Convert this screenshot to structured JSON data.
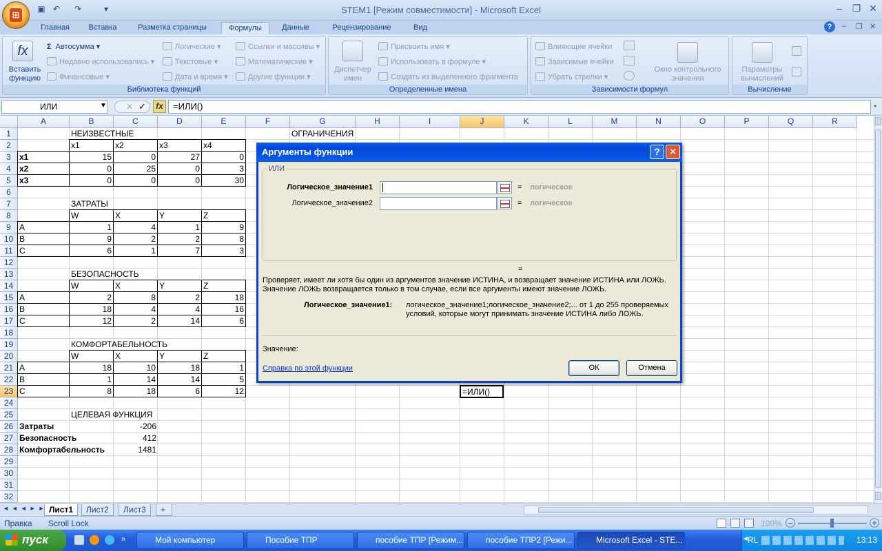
{
  "window": {
    "title": "STEM1  [Режим совместимости] - Microsoft Excel"
  },
  "tabs": [
    {
      "label": "Главная"
    },
    {
      "label": "Вставка"
    },
    {
      "label": "Разметка страницы"
    },
    {
      "label": "Формулы",
      "active": true
    },
    {
      "label": "Данные"
    },
    {
      "label": "Рецензирование"
    },
    {
      "label": "Вид"
    }
  ],
  "ribbon": {
    "g1": {
      "label": "Библиотека функций",
      "insert": "Вставить функцию",
      "autosum": "Автосумма",
      "recent": "Недавно использовались",
      "financial": "Финансовые",
      "logical": "Логические",
      "text": "Текстовые",
      "datetime": "Дата и время",
      "lookup": "Ссылки и массивы",
      "math": "Математические",
      "more": "Другие функции"
    },
    "g2": {
      "label": "Определенные имена",
      "manager": "Диспетчер имен",
      "define": "Присвоить имя",
      "use": "Использовать в формуле",
      "create": "Создать из выделенного фрагмента"
    },
    "g3": {
      "label": "Зависимости формул",
      "precedents": "Влияющие ячейки",
      "dependents": "Зависимые ячейки",
      "remove": "Убрать стрелки",
      "watch": "Окно контрольного значения"
    },
    "g4": {
      "label": "Вычисление",
      "options": "Параметры вычислений"
    }
  },
  "formula_bar": {
    "name_box": "ИЛИ",
    "formula": "=ИЛИ()"
  },
  "columns": [
    "A",
    "B",
    "C",
    "D",
    "E",
    "F",
    "G",
    "H",
    "I",
    "J",
    "K",
    "L",
    "M",
    "N",
    "O",
    "P",
    "Q",
    "R"
  ],
  "rows": [
    "1",
    "2",
    "3",
    "4",
    "5",
    "6",
    "7",
    "8",
    "9",
    "10",
    "11",
    "12",
    "13",
    "14",
    "15",
    "16",
    "17",
    "18",
    "19",
    "20",
    "21",
    "22",
    "23",
    "24",
    "25",
    "26",
    "27",
    "28",
    "29",
    "30",
    "31",
    "32"
  ],
  "cells": {
    "B1": "НЕИЗВЕСТНЫЕ",
    "G1": "ОГРАНИЧЕНИЯ",
    "B2": "x1",
    "C2": "x2",
    "D2": "x3",
    "E2": "x4",
    "A3": "x1",
    "B3": "15",
    "C3": "0",
    "D3": "27",
    "E3": "0",
    "A4": "x2",
    "B4": "0",
    "C4": "25",
    "D4": "0",
    "E4": "3",
    "A5": "x3",
    "B5": "0",
    "C5": "0",
    "D5": "0",
    "E5": "30",
    "B7": "ЗАТРАТЫ",
    "B8": "W",
    "C8": "X",
    "D8": "Y",
    "E8": "Z",
    "A9": "A",
    "B9": "1",
    "C9": "4",
    "D9": "1",
    "E9": "9",
    "A10": "B",
    "B10": "9",
    "C10": "2",
    "D10": "2",
    "E10": "8",
    "A11": "C",
    "B11": "6",
    "C11": "1",
    "D11": "7",
    "E11": "3",
    "B13": "БЕЗОПАСНОСТЬ",
    "B14": "W",
    "C14": "X",
    "D14": "Y",
    "E14": "Z",
    "A15": "A",
    "B15": "2",
    "C15": "8",
    "D15": "2",
    "E15": "18",
    "A16": "B",
    "B16": "18",
    "C16": "4",
    "D16": "4",
    "E16": "16",
    "A17": "C",
    "B17": "12",
    "C17": "2",
    "D17": "14",
    "E17": "6",
    "B19": "КОМФОРТАБЕЛЬНОСТЬ",
    "B20": "W",
    "C20": "X",
    "D20": "Y",
    "E20": "Z",
    "A21": "A",
    "B21": "18",
    "C21": "10",
    "D21": "18",
    "E21": "1",
    "A22": "B",
    "B22": "1",
    "C22": "14",
    "D22": "14",
    "E22": "5",
    "A23": "C",
    "B23": "8",
    "C23": "18",
    "D23": "6",
    "E23": "12",
    "B25": "ЦЕЛЕВАЯ ФУНКЦИЯ",
    "A26": "Затраты",
    "C26": "-206",
    "A27": "Безопасность",
    "C27": "412",
    "A28": "Комфортабельность",
    "C28": "1481",
    "J23": "=ИЛИ()"
  },
  "sheets": [
    {
      "label": "Лист1",
      "active": true
    },
    {
      "label": "Лист2"
    },
    {
      "label": "Лист3"
    }
  ],
  "status": {
    "mode": "Правка",
    "scroll_lock": "Scroll Lock",
    "zoom": "100%"
  },
  "dialog": {
    "title": "Аргументы функции",
    "function_name": "ИЛИ",
    "arg1_label": "Логическое_значение1",
    "arg2_label": "Логическое_значение2",
    "arg_value": "логическое",
    "eq": "=",
    "description": "Проверяет, имеет ли хотя бы один из аргументов значение ИСТИНА, и возвращает значение ИСТИНА или ЛОЖЬ. Значение ЛОЖЬ возвращается только в том случае, если все аргументы имеют значение ЛОЖЬ.",
    "arg_help_label": "Логическое_значение1:",
    "arg_help": "логическое_значение1;логическое_значение2;... от 1 до 255 проверяемых условий, которые могут принимать значение ИСТИНА либо ЛОЖЬ.",
    "value_label": "Значение:",
    "help_link": "Справка по этой функции",
    "ok": "ОК",
    "cancel": "Отмена"
  },
  "taskbar": {
    "start": "пуск",
    "items": [
      {
        "label": "Мой компьютер"
      },
      {
        "label": "Пособие ТПР"
      },
      {
        "label": "пособие ТПР [Режим..."
      },
      {
        "label": "пособие ТПР2 [Режи..."
      },
      {
        "label": "Microsoft Excel - STE...",
        "active": true
      }
    ],
    "lang": "RL",
    "clock": "13:13"
  }
}
